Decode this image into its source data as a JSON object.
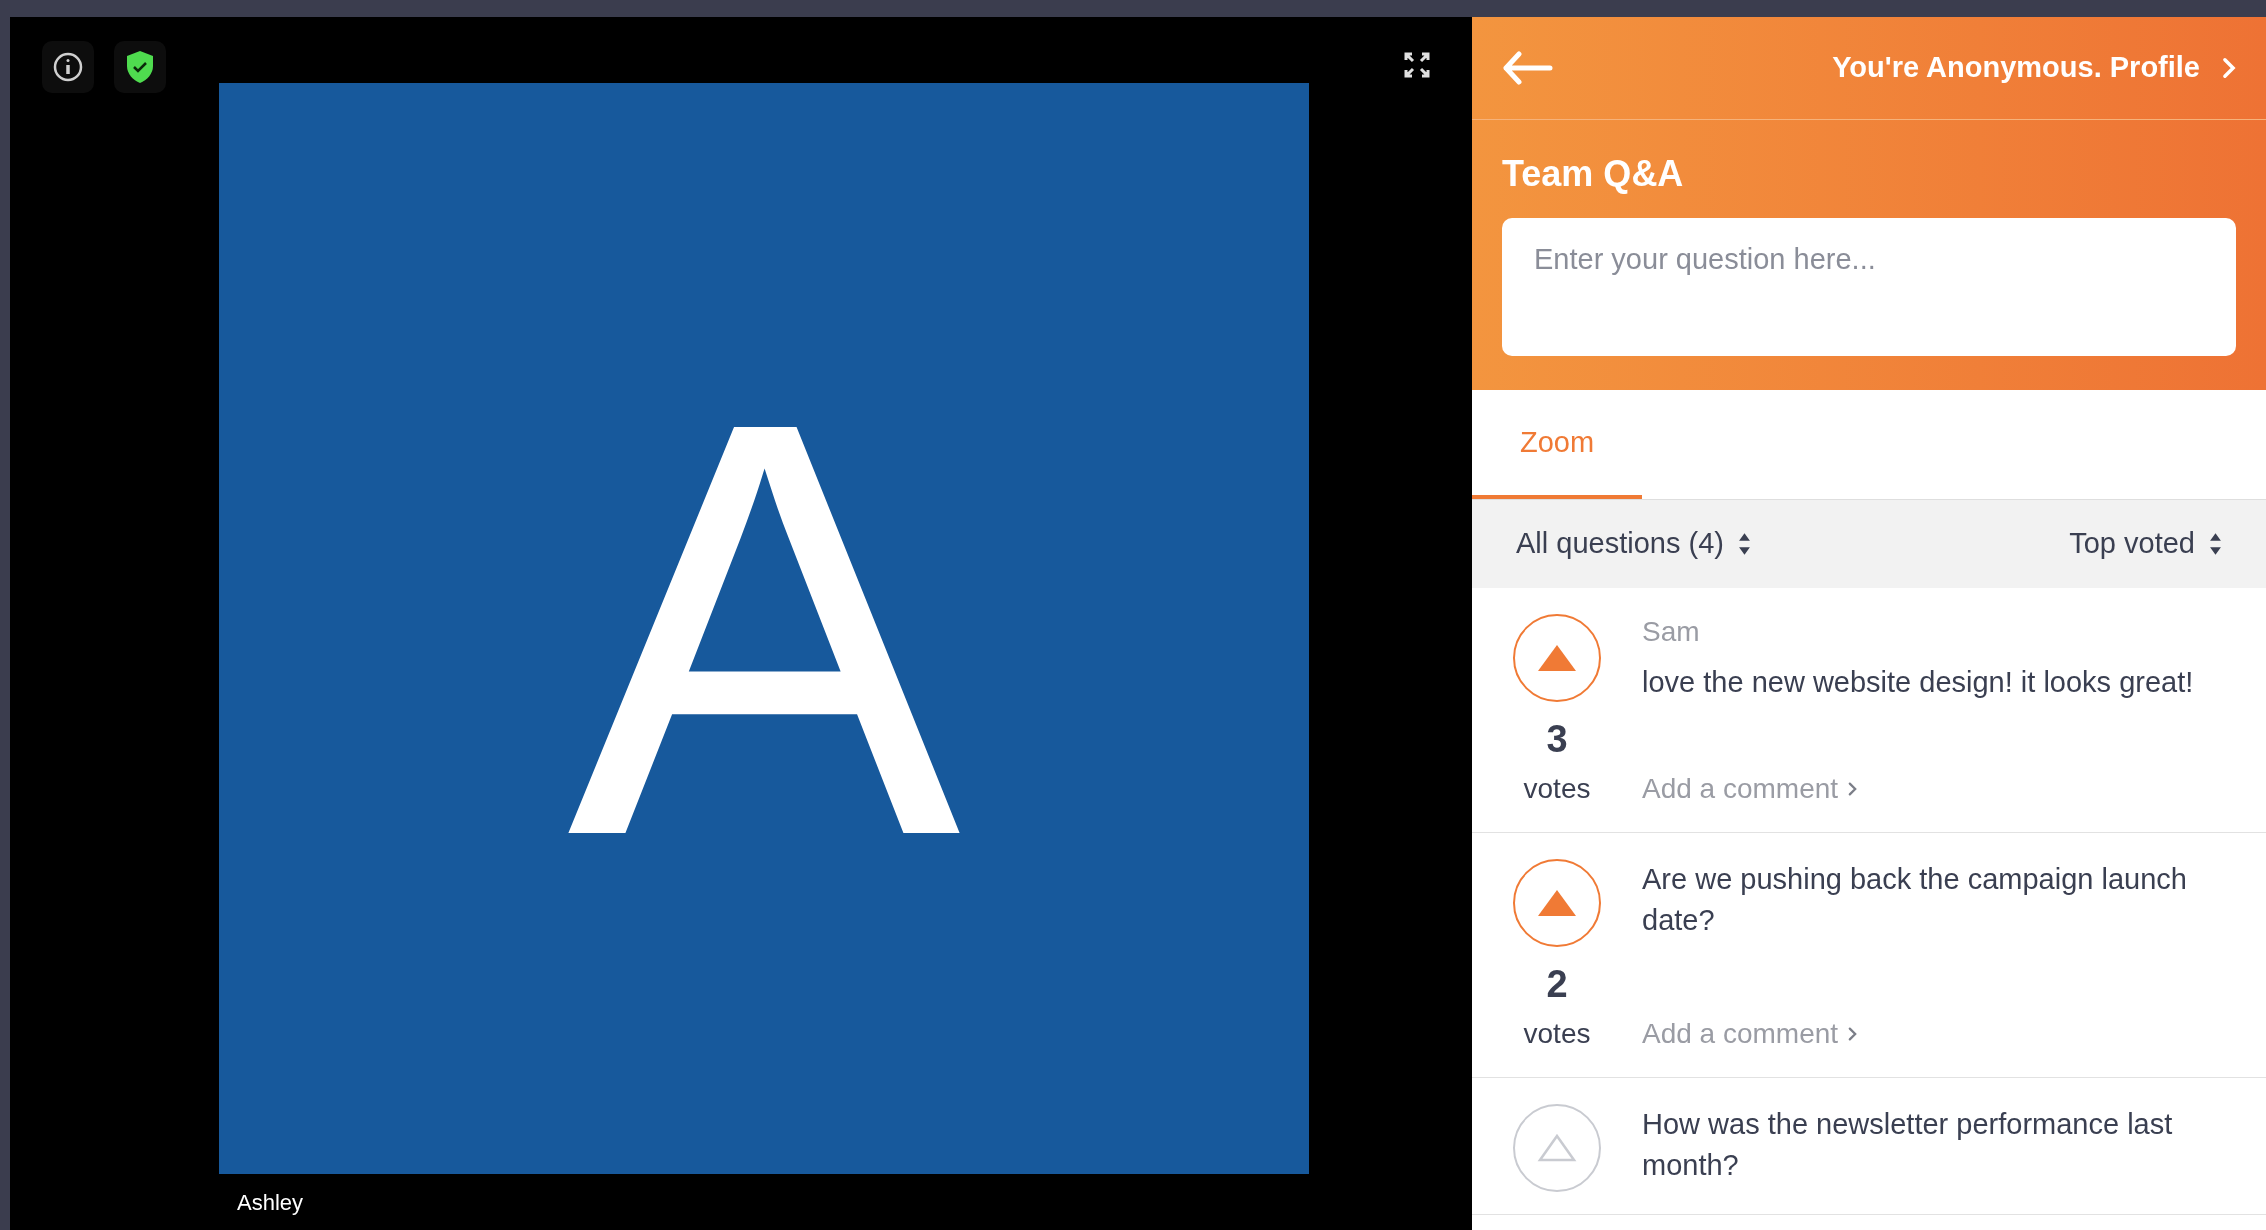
{
  "video": {
    "initial": "A",
    "participant": "Ashley"
  },
  "panel": {
    "profile_link": "You're Anonymous. Profile",
    "title": "Team Q&A",
    "question_field": {
      "placeholder": "Enter your question here..."
    },
    "tabs": [
      {
        "label": "Zoom",
        "selected": true
      }
    ],
    "filter": "All questions (4)",
    "sort": "Top voted",
    "questions": [
      {
        "author": "Sam",
        "text": "love the new website design! it looks great!",
        "votes": "3",
        "votes_label": "votes",
        "comment_link": "Add a comment",
        "voted": true
      },
      {
        "text": "Are we pushing back the campaign launch date?",
        "votes": "2",
        "votes_label": "votes",
        "comment_link": "Add a comment",
        "voted": true
      },
      {
        "text": "How was the newsletter performance last month?",
        "voted": false
      }
    ]
  }
}
